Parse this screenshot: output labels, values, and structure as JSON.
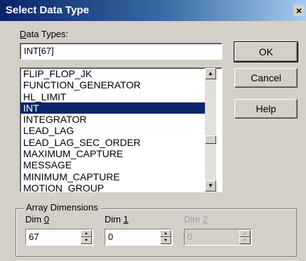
{
  "window": {
    "title": "Select Data Type",
    "close_glyph": "×"
  },
  "data_types": {
    "label_accel": "D",
    "label_rest": "ata Types:",
    "input_value": "INT[67]"
  },
  "list": {
    "items": [
      "FLIP_FLOP_JK",
      "FUNCTION_GENERATOR",
      "HL_LIMIT",
      "INT",
      "INTEGRATOR",
      "LEAD_LAG",
      "LEAD_LAG_SEC_ORDER",
      "MAXIMUM_CAPTURE",
      "MESSAGE",
      "MINIMUM_CAPTURE",
      "MOTION_GROUP"
    ],
    "selected": "INT",
    "scroll_up_glyph": "▲",
    "scroll_down_glyph": "▼"
  },
  "buttons": {
    "ok": "OK",
    "cancel": "Cancel",
    "help": "Help"
  },
  "array_dimensions": {
    "legend": "Array Dimensions",
    "dim0": {
      "label_prefix": "Dim ",
      "label_accel": "0",
      "value": "67",
      "enabled": true
    },
    "dim1": {
      "label_prefix": "Dim ",
      "label_accel": "1",
      "value": "0",
      "enabled": true
    },
    "dim2": {
      "label_prefix": "Dim ",
      "label_accel": "2",
      "value": "0",
      "enabled": false
    },
    "spin_up_glyph": "▲",
    "spin_down_glyph": "▼"
  },
  "colors": {
    "titlebar": "#0a246a",
    "selection": "#0a246a",
    "face": "#d4d0c8"
  }
}
